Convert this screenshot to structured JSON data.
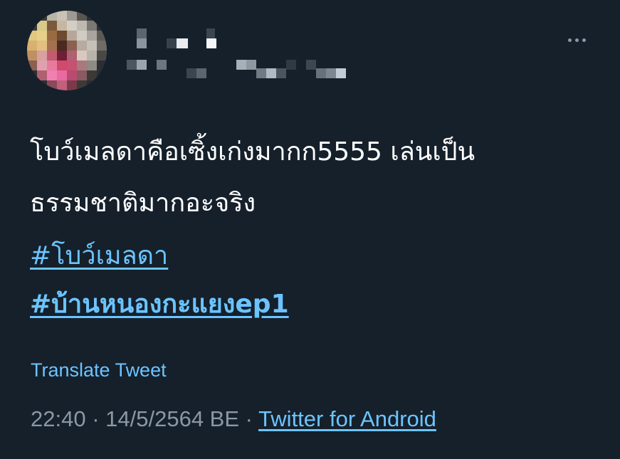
{
  "tweet": {
    "text": "โบว์เมลดาคือเซิ้งเก่งมากก5555 เล่นเป็น\nธรรมชาติมากอะจริง",
    "hashtags": [
      "#โบว์เมลดา",
      "#บ้านหนองกะแยงep1"
    ],
    "translate_label": "Translate Tweet",
    "time": "22:40",
    "separator": "·",
    "date": "14/5/2564 BE",
    "source": "Twitter for Android"
  },
  "icons": {
    "more": "more-horizontal-icon"
  },
  "colors": {
    "background": "#15202b",
    "text": "#ffffff",
    "link": "#6cc4ff",
    "muted": "#8b98a5"
  }
}
